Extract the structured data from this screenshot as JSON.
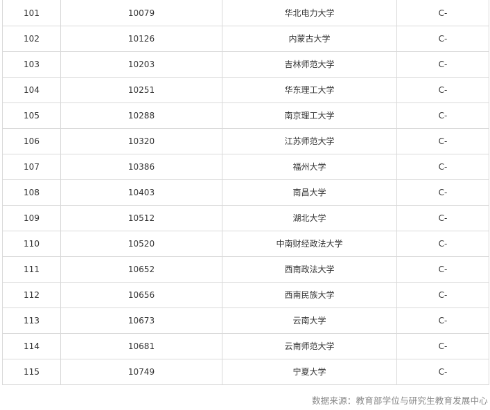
{
  "table": {
    "rows": [
      {
        "rank": "101",
        "code": "10079",
        "name": "华北电力大学",
        "grade": "C-"
      },
      {
        "rank": "102",
        "code": "10126",
        "name": "内蒙古大学",
        "grade": "C-"
      },
      {
        "rank": "103",
        "code": "10203",
        "name": "吉林师范大学",
        "grade": "C-"
      },
      {
        "rank": "104",
        "code": "10251",
        "name": "华东理工大学",
        "grade": "C-"
      },
      {
        "rank": "105",
        "code": "10288",
        "name": "南京理工大学",
        "grade": "C-"
      },
      {
        "rank": "106",
        "code": "10320",
        "name": "江苏师范大学",
        "grade": "C-"
      },
      {
        "rank": "107",
        "code": "10386",
        "name": "福州大学",
        "grade": "C-"
      },
      {
        "rank": "108",
        "code": "10403",
        "name": "南昌大学",
        "grade": "C-"
      },
      {
        "rank": "109",
        "code": "10512",
        "name": "湖北大学",
        "grade": "C-"
      },
      {
        "rank": "110",
        "code": "10520",
        "name": "中南财经政法大学",
        "grade": "C-"
      },
      {
        "rank": "111",
        "code": "10652",
        "name": "西南政法大学",
        "grade": "C-"
      },
      {
        "rank": "112",
        "code": "10656",
        "name": "西南民族大学",
        "grade": "C-"
      },
      {
        "rank": "113",
        "code": "10673",
        "name": "云南大学",
        "grade": "C-"
      },
      {
        "rank": "114",
        "code": "10681",
        "name": "云南师范大学",
        "grade": "C-"
      },
      {
        "rank": "115",
        "code": "10749",
        "name": "宁夏大学",
        "grade": "C-"
      }
    ]
  },
  "footer": {
    "source": "数据来源：教育部学位与研究生教育发展中心"
  },
  "colors": {
    "text": "#333333",
    "border": "#d9d9d9",
    "note": "#888888",
    "background": "#ffffff"
  }
}
